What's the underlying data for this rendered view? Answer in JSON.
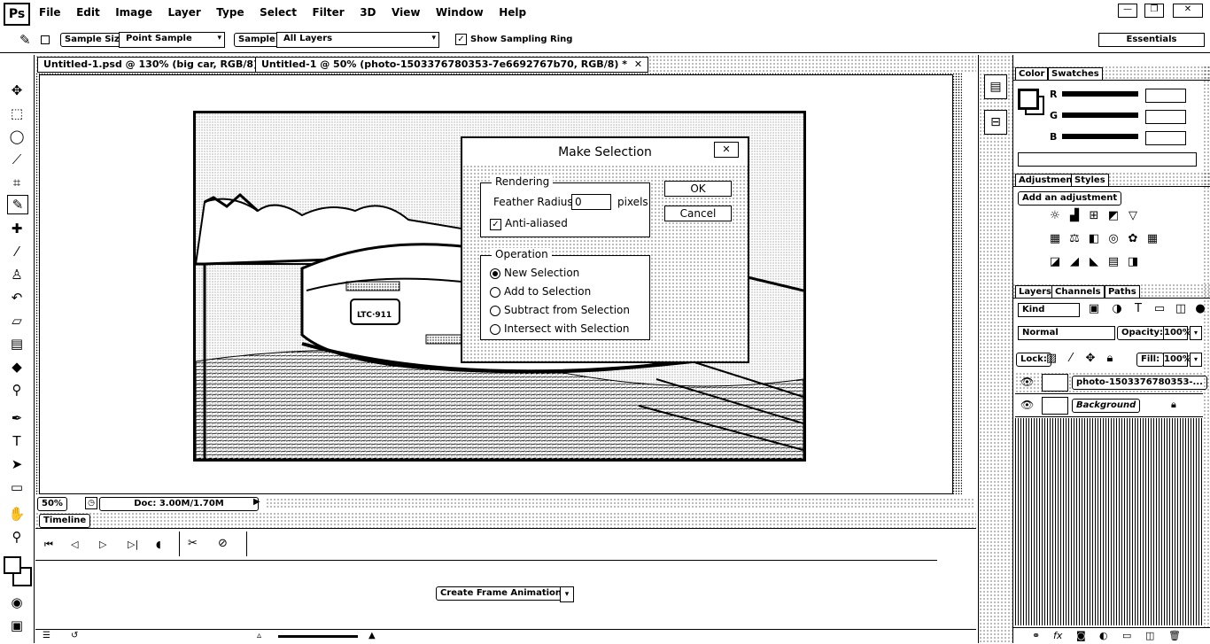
{
  "app": {
    "logo": "Ps"
  },
  "menu": [
    "File",
    "Edit",
    "Image",
    "Layer",
    "Type",
    "Select",
    "Filter",
    "3D",
    "View",
    "Window",
    "Help"
  ],
  "window_controls": {
    "minimize": "—",
    "restore": "❐",
    "close": "✕"
  },
  "options_bar": {
    "sample_size_label": "Sample Size:",
    "sample_size_value": "Point Sample",
    "sample_label": "Sample:",
    "sample_value": "All Layers",
    "show_ring_label": "Show Sampling Ring",
    "workspace": "Essentials"
  },
  "doc_tabs": [
    {
      "label": "Untitled-1.psd @ 130% (big car, RGB/8)",
      "close": "✕"
    },
    {
      "label": "Untitled-1 @ 50% (photo-1503376780353-7e6692767b70, RGB/8) *",
      "close": "✕"
    }
  ],
  "status": {
    "zoom": "50%",
    "doc": "Doc: 3.00M/1.70M"
  },
  "dialog": {
    "title": "Make Selection",
    "close": "✕",
    "rendering_label": "Rendering",
    "feather_label": "Feather Radius:",
    "feather_value": "0",
    "feather_unit": "pixels",
    "anti_aliased": "Anti-aliased",
    "operation_label": "Operation",
    "options": [
      "New Selection",
      "Add to Selection",
      "Subtract from Selection",
      "Intersect with Selection"
    ],
    "selected_option": "New Selection",
    "ok": "OK",
    "cancel": "Cancel"
  },
  "timeline": {
    "tab": "Timeline",
    "create_button": "Create Frame Animation"
  },
  "color_panel": {
    "tabs": [
      "Color",
      "Swatches"
    ],
    "channels": [
      "R",
      "G",
      "B"
    ]
  },
  "adjustments_panel": {
    "tabs": [
      "Adjustments",
      "Styles"
    ],
    "add_label": "Add an adjustment"
  },
  "layers_panel": {
    "tabs": [
      "Layers",
      "Channels",
      "Paths"
    ],
    "filter": "Kind",
    "blend_mode": "Normal",
    "opacity_label": "Opacity:",
    "opacity_value": "100%",
    "lock_label": "Lock:",
    "fill_label": "Fill:",
    "fill_value": "100%",
    "layers": [
      {
        "name": "photo-1503376780353-..."
      },
      {
        "name": "Background"
      }
    ]
  }
}
